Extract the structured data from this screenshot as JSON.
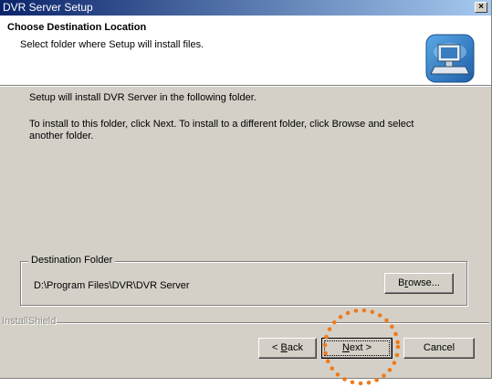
{
  "window": {
    "title": "DVR Server Setup",
    "close_glyph": "×"
  },
  "header": {
    "title": "Choose Destination Location",
    "subtitle": "Select folder where Setup will install files.",
    "icon": "setup-computer-icon"
  },
  "body": {
    "line1": "Setup will install  DVR Server in the following folder.",
    "line2": "To install to this folder, click Next. To install to a different folder, click Browse and select",
    "line3": "another folder."
  },
  "destination": {
    "group_label": "Destination Folder",
    "path": "D:\\Program Files\\DVR\\DVR Server"
  },
  "buttons": {
    "browse": {
      "pre": "B",
      "acc": "r",
      "post": "owse..."
    },
    "back": {
      "pre": "< ",
      "acc": "B",
      "post": "ack"
    },
    "next": {
      "pre": "",
      "acc": "N",
      "post": "ext >"
    },
    "cancel": "Cancel"
  },
  "brand": "InstallShield",
  "colors": {
    "titlebar_start": "#0a246a",
    "titlebar_end": "#a6caf0",
    "dialog_face": "#d4d0c8",
    "highlight_dots": "#f07a1a"
  }
}
